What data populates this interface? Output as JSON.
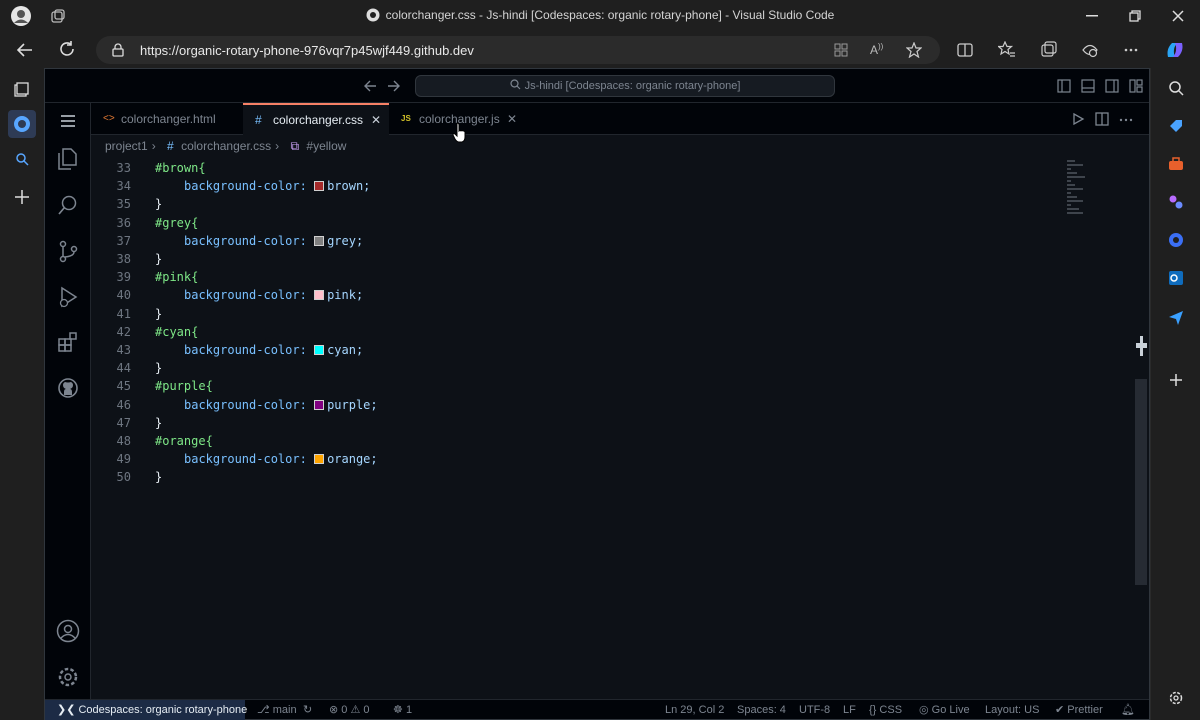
{
  "browser": {
    "window_title": "colorchanger.css - Js-hindi [Codespaces: organic rotary-phone] - Visual Studio Code",
    "url": "https://organic-rotary-phone-976vqr7p45wjf449.github.dev"
  },
  "vscode": {
    "command_center": "Js-hindi [Codespaces: organic rotary-phone]",
    "tabs": [
      {
        "label": "colorchanger.html",
        "icon": "<>",
        "active": false
      },
      {
        "label": "colorchanger.css",
        "icon": "#",
        "active": true
      },
      {
        "label": "colorchanger.js",
        "icon": "JS",
        "active": false
      }
    ],
    "breadcrumb": {
      "folder": "project1",
      "file": "colorchanger.css",
      "symbol": "#yellow"
    },
    "code_lines": [
      {
        "num": "33",
        "selector": "#brown{"
      },
      {
        "num": "34",
        "prop": "background-color:",
        "color": "#a52a2a",
        "value": "brown;"
      },
      {
        "num": "35",
        "close": "}"
      },
      {
        "num": "36",
        "selector": "#grey{"
      },
      {
        "num": "37",
        "prop": "background-color:",
        "color": "#808080",
        "value": "grey;"
      },
      {
        "num": "38",
        "close": "}"
      },
      {
        "num": "39",
        "selector": "#pink{"
      },
      {
        "num": "40",
        "prop": "background-color:",
        "color": "#ffc0cb",
        "value": "pink;"
      },
      {
        "num": "41",
        "close": "}"
      },
      {
        "num": "42",
        "selector": "#cyan{"
      },
      {
        "num": "43",
        "prop": "background-color:",
        "color": "#00ffff",
        "value": "cyan;"
      },
      {
        "num": "44",
        "close": "}"
      },
      {
        "num": "45",
        "selector": "#purple{"
      },
      {
        "num": "46",
        "prop": "background-color:",
        "color": "#800080",
        "value": "purple;"
      },
      {
        "num": "47",
        "close": "}"
      },
      {
        "num": "48",
        "selector": "#orange{"
      },
      {
        "num": "49",
        "prop": "background-color:",
        "color": "#ffa500",
        "value": "orange;"
      },
      {
        "num": "50",
        "close": "}"
      }
    ],
    "status": {
      "remote": "Codespaces: organic rotary-phone",
      "branch": "main",
      "errors": "0",
      "warnings": "0",
      "ports": "1",
      "position": "Ln 29, Col 2",
      "spaces": "Spaces: 4",
      "encoding": "UTF-8",
      "eol": "LF",
      "language": "CSS",
      "go_live": "Go Live",
      "layout": "Layout: US",
      "prettier": "Prettier"
    }
  },
  "colors": {
    "accent": "#f78166",
    "editor_bg": "#0d1117",
    "selector": "#7ee787",
    "property": "#79c0ff"
  }
}
